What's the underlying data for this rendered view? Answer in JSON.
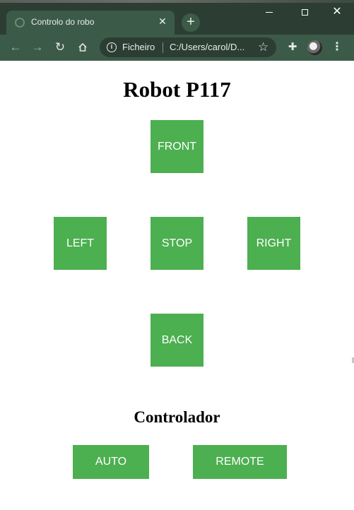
{
  "browser": {
    "tab_title": "Controlo do robo",
    "tab_close_glyph": "✕",
    "new_tab_glyph": "+",
    "window_close_glyph": "✕",
    "address": {
      "scheme_label": "Ficheiro",
      "url": "C:/Users/carol/D...",
      "info_glyph": "i",
      "star_glyph": "☆"
    },
    "icons": {
      "back": "←",
      "forward": "→",
      "reload": "↻",
      "extensions": "✚",
      "menu": "⋮"
    }
  },
  "page": {
    "title": "Robot P117",
    "controls": {
      "front": "FRONT",
      "left": "LEFT",
      "stop": "STOP",
      "right": "RIGHT",
      "back": "BACK"
    },
    "controller_heading": "Controlador",
    "modes": {
      "auto": "AUTO",
      "remote": "REMOTE"
    }
  },
  "colors": {
    "button_green": "#4caf50",
    "chrome_dark": "#2c3e33",
    "chrome_toolbar": "#3c5a48"
  }
}
